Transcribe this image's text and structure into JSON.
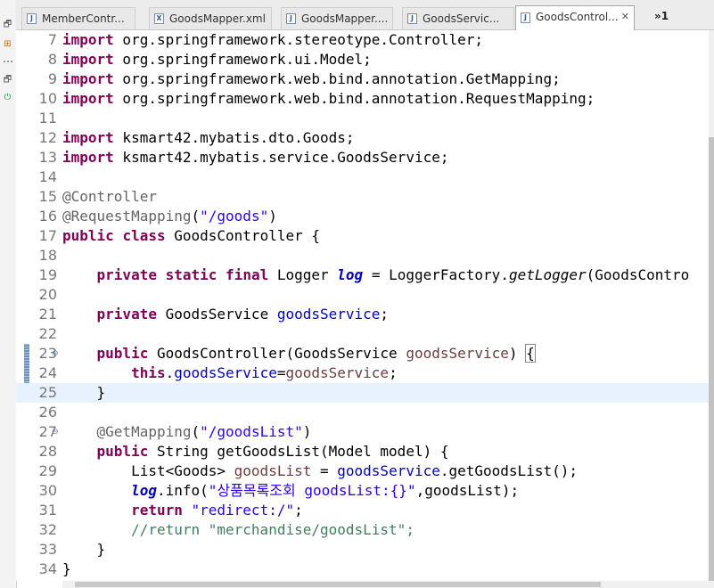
{
  "tabs": [
    {
      "label": "MemberContr...",
      "icon": "java-file-icon",
      "active": false
    },
    {
      "label": "GoodsMapper.xml",
      "icon": "xml-file-icon",
      "active": false
    },
    {
      "label": "GoodsMapper....",
      "icon": "java-file-icon",
      "active": false
    },
    {
      "label": "GoodsServic...",
      "icon": "java-file-icon",
      "active": false
    },
    {
      "label": "GoodsControl...",
      "icon": "java-file-icon",
      "active": true
    }
  ],
  "overflow_label": "»1",
  "close_glyph": "✕",
  "lines": [
    {
      "n": "7",
      "segs": [
        [
          "kw",
          "import"
        ],
        [
          "p",
          " org.springframework.stereotype.Controller;"
        ]
      ]
    },
    {
      "n": "8",
      "segs": [
        [
          "kw",
          "import"
        ],
        [
          "p",
          " org.springframework.ui.Model;"
        ]
      ]
    },
    {
      "n": "9",
      "segs": [
        [
          "kw",
          "import"
        ],
        [
          "p",
          " org.springframework.web.bind.annotation.GetMapping;"
        ]
      ]
    },
    {
      "n": "10",
      "segs": [
        [
          "kw",
          "import"
        ],
        [
          "p",
          " org.springframework.web.bind.annotation.RequestMapping;"
        ]
      ]
    },
    {
      "n": "11",
      "segs": []
    },
    {
      "n": "12",
      "segs": [
        [
          "kw",
          "import"
        ],
        [
          "p",
          " ksmart42.mybatis.dto.Goods;"
        ]
      ]
    },
    {
      "n": "13",
      "segs": [
        [
          "kw",
          "import"
        ],
        [
          "p",
          " ksmart42.mybatis.service.GoodsService;"
        ]
      ]
    },
    {
      "n": "14",
      "segs": []
    },
    {
      "n": "15",
      "segs": [
        [
          "ann",
          "@Controller"
        ]
      ]
    },
    {
      "n": "16",
      "segs": [
        [
          "ann",
          "@RequestMapping"
        ],
        [
          "p",
          "("
        ],
        [
          "str",
          "\"/goods\""
        ],
        [
          "p",
          ")"
        ]
      ]
    },
    {
      "n": "17",
      "segs": [
        [
          "kw",
          "public"
        ],
        [
          "p",
          " "
        ],
        [
          "kw",
          "class"
        ],
        [
          "p",
          " GoodsController {"
        ]
      ]
    },
    {
      "n": "18",
      "segs": []
    },
    {
      "n": "19",
      "segs": [
        [
          "p",
          "    "
        ],
        [
          "kw",
          "private"
        ],
        [
          "p",
          " "
        ],
        [
          "kw",
          "static"
        ],
        [
          "p",
          " "
        ],
        [
          "kw",
          "final"
        ],
        [
          "p",
          " Logger "
        ],
        [
          "sfld",
          "log"
        ],
        [
          "p",
          " = LoggerFactory."
        ],
        [
          "smeth",
          "getLogger"
        ],
        [
          "p",
          "(GoodsContro"
        ]
      ]
    },
    {
      "n": "20",
      "segs": []
    },
    {
      "n": "21",
      "segs": [
        [
          "p",
          "    "
        ],
        [
          "kw",
          "private"
        ],
        [
          "p",
          " GoodsService "
        ],
        [
          "fld",
          "goodsService"
        ],
        [
          "p",
          ";"
        ]
      ]
    },
    {
      "n": "22",
      "segs": []
    },
    {
      "n": "23",
      "fold": true,
      "segs": [
        [
          "p",
          "    "
        ],
        [
          "kw",
          "public"
        ],
        [
          "p",
          " GoodsController(GoodsService "
        ],
        [
          "param",
          "goodsService"
        ],
        [
          "p",
          ") "
        ],
        [
          "brk",
          "{"
        ]
      ]
    },
    {
      "n": "24",
      "segs": [
        [
          "p",
          "        "
        ],
        [
          "kw",
          "this"
        ],
        [
          "p",
          "."
        ],
        [
          "fld",
          "goodsService"
        ],
        [
          "p",
          "="
        ],
        [
          "param",
          "goodsService"
        ],
        [
          "p",
          ";"
        ]
      ]
    },
    {
      "n": "25",
      "current": true,
      "segs": [
        [
          "p",
          "    }"
        ]
      ]
    },
    {
      "n": "26",
      "segs": []
    },
    {
      "n": "27",
      "fold": true,
      "segs": [
        [
          "p",
          "    "
        ],
        [
          "ann",
          "@GetMapping"
        ],
        [
          "p",
          "("
        ],
        [
          "str",
          "\"/goodsList\""
        ],
        [
          "p",
          ")"
        ]
      ]
    },
    {
      "n": "28",
      "segs": [
        [
          "p",
          "    "
        ],
        [
          "kw",
          "public"
        ],
        [
          "p",
          " String getGoodsList(Model model) {"
        ]
      ]
    },
    {
      "n": "29",
      "segs": [
        [
          "p",
          "        List<Goods> "
        ],
        [
          "param",
          "goodsList"
        ],
        [
          "p",
          " = "
        ],
        [
          "fld",
          "goodsService"
        ],
        [
          "p",
          ".getGoodsList();"
        ]
      ]
    },
    {
      "n": "30",
      "segs": [
        [
          "p",
          "        "
        ],
        [
          "sfld",
          "log"
        ],
        [
          "p",
          ".info("
        ],
        [
          "str",
          "\"상품목록조회 goodsList:{}\""
        ],
        [
          "p",
          ",goodsList);"
        ]
      ]
    },
    {
      "n": "31",
      "segs": [
        [
          "p",
          "        "
        ],
        [
          "kw",
          "return"
        ],
        [
          "p",
          " "
        ],
        [
          "str",
          "\"redirect:/\""
        ],
        [
          "p",
          ";"
        ]
      ]
    },
    {
      "n": "32",
      "segs": [
        [
          "p",
          "        "
        ],
        [
          "cmt",
          "//return \"merchandise/goodsList\";"
        ]
      ]
    },
    {
      "n": "33",
      "segs": [
        [
          "p",
          "    }"
        ]
      ]
    },
    {
      "n": "34",
      "segs": [
        [
          "p",
          "}"
        ]
      ]
    }
  ]
}
